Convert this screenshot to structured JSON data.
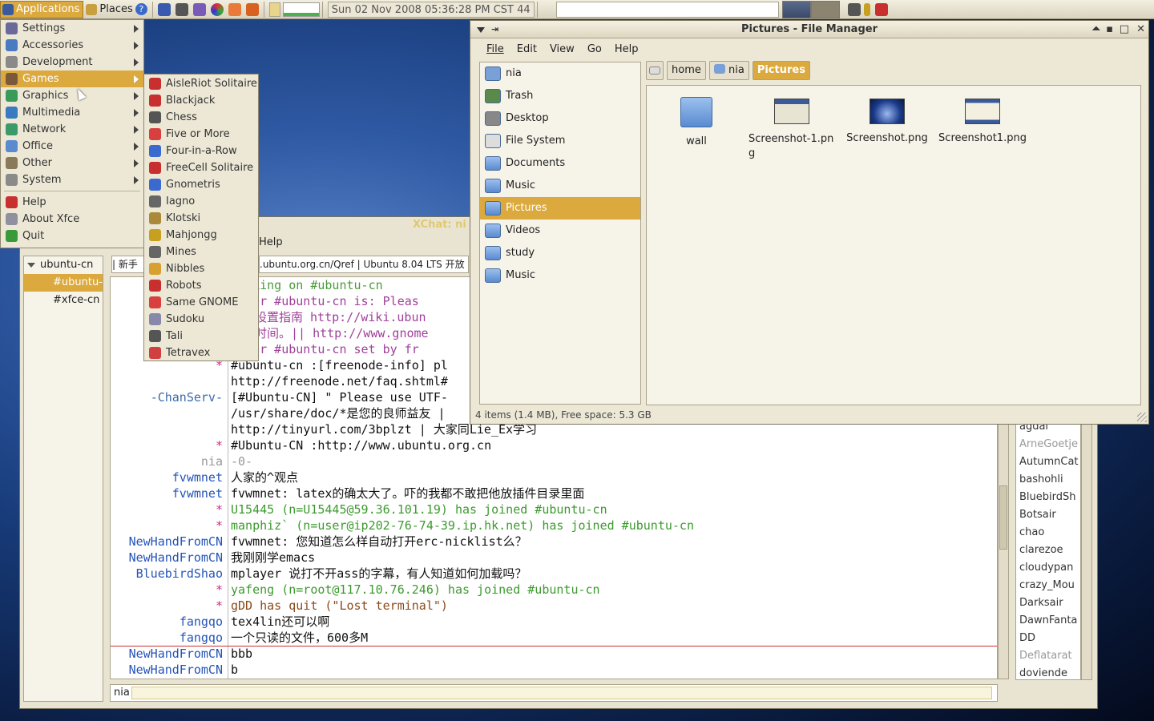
{
  "panel": {
    "applications": "Applications",
    "places": "Places",
    "clock": "Sun 02 Nov 2008 05:36:28 PM CST 44"
  },
  "app_menu": {
    "items": [
      {
        "label": "Settings",
        "sub": true
      },
      {
        "label": "Accessories",
        "sub": true
      },
      {
        "label": "Development",
        "sub": true
      },
      {
        "label": "Games",
        "sub": true,
        "selected": true
      },
      {
        "label": "Graphics",
        "sub": true
      },
      {
        "label": "Multimedia",
        "sub": true
      },
      {
        "label": "Network",
        "sub": true
      },
      {
        "label": "Office",
        "sub": true
      },
      {
        "label": "Other",
        "sub": true
      },
      {
        "label": "System",
        "sub": true
      },
      {
        "label": "Help"
      },
      {
        "label": "About Xfce"
      },
      {
        "label": "Quit"
      }
    ]
  },
  "games_menu": {
    "items": [
      "AisleRiot Solitaire",
      "Blackjack",
      "Chess",
      "Five or More",
      "Four-in-a-Row",
      "FreeCell Solitaire",
      "Gnometris",
      "Iagno",
      "Klotski",
      "Mahjongg",
      "Mines",
      "Nibbles",
      "Robots",
      "Same GNOME",
      "Sudoku",
      "Tali",
      "Tetravex"
    ]
  },
  "xchat": {
    "title_fragment": "XChat: ni",
    "menu_help": "Help",
    "tree": {
      "server": "ubuntu-cn",
      "channels": [
        "#ubuntu-",
        "#xfce-cn"
      ]
    },
    "tab_fragment": "| 新手",
    "topic": ".ubuntu.org.cn/Qref | Ubuntu 8.04 LTS 开放",
    "lines": [
      {
        "nick": "",
        "text": "talking on #ubuntu-cn",
        "color": "#4a9a3a"
      },
      {
        "nick": "",
        "text": "c for #ubuntu-cn is: Pleas",
        "color": "#a0409a"
      },
      {
        "nick": "",
        "text": "中文设置指南 http://wiki.ubun",
        "color": "#a0409a"
      },
      {
        "nick": "",
        "text": "大家时间。|| http://www.gnome",
        "color": "#a0409a"
      },
      {
        "nick": "",
        "text": "c for #ubuntu-cn set by fr",
        "color": "#a0409a"
      },
      {
        "nick": "*",
        "text": "#ubuntu-cn :[freenode-info] pl",
        "color": "#111"
      },
      {
        "nick": "",
        "text": "http://freenode.net/faq.shtml#",
        "color": "#111"
      },
      {
        "nick": "-ChanServ-",
        "text": "[#Ubuntu-CN] \" Please use UTF-",
        "color": "#111"
      },
      {
        "nick": "",
        "text": "/usr/share/doc/*是您的良师益友 |",
        "color": "#111"
      },
      {
        "nick": "",
        "text": "http://tinyurl.com/3bplzt | 大家同Lie_Ex学习",
        "color": "#111"
      },
      {
        "nick": "*",
        "text": "#Ubuntu-CN :http://www.ubuntu.org.cn",
        "color": "#111"
      },
      {
        "nick": "nia",
        "text": "-0-",
        "color": "#999"
      },
      {
        "nick": "fvwmnet",
        "text": "人家的^观点",
        "color": "#111"
      },
      {
        "nick": "fvwmnet",
        "text": "fvwmnet: latex的确太大了。吓的我都不敢把他放插件目录里面",
        "color": "#111"
      },
      {
        "nick": "*",
        "text": "U15445 (n=U15445@59.36.101.19) has joined #ubuntu-cn",
        "color": "#3c9a2e"
      },
      {
        "nick": "*",
        "text": "manphiz` (n=user@ip202-76-74-39.ip.hk.net) has joined #ubuntu-cn",
        "color": "#3c9a2e"
      },
      {
        "nick": "NewHandFromCN",
        "text": "fvwmnet: 您知道怎么样自动打开erc-nicklist么？",
        "color": "#111"
      },
      {
        "nick": "NewHandFromCN",
        "text": "我刚刚学emacs",
        "color": "#111"
      },
      {
        "nick": "BluebirdShao",
        "text": "mplayer 说打不开ass的字幕，有人知道如何加载吗？",
        "color": "#111"
      },
      {
        "nick": "*",
        "text": "yafeng (n=root@117.10.76.246) has joined #ubuntu-cn",
        "color": "#3c9a2e"
      },
      {
        "nick": "*",
        "text": "gDD has quit (\"Lost terminal\")",
        "color": "#8a4a1a"
      },
      {
        "nick": "fangqo",
        "text": "tex4lin还可以啊",
        "color": "#111"
      },
      {
        "nick": "fangqo",
        "text": "一个只读的文件，600多M",
        "color": "#111"
      },
      {
        "nick": "NewHandFromCN",
        "text": "bbb",
        "color": "#111"
      },
      {
        "nick": "NewHandFromCN",
        "text": "b",
        "color": "#111"
      }
    ],
    "input_nick": "nia",
    "nicks": [
      "agdai",
      "ArneGoetje",
      "AutumnCat",
      "bashohli",
      "BluebirdSh",
      "Botsair",
      "chao",
      "clarezoe",
      "cloudypan",
      "crazy_Mou",
      "Darksair",
      "DawnFanta",
      "DD",
      "Deflatarat",
      "doviende"
    ]
  },
  "fm": {
    "title": "Pictures - File Manager",
    "menu": [
      "File",
      "Edit",
      "View",
      "Go",
      "Help"
    ],
    "sidebar": [
      {
        "label": "nia"
      },
      {
        "label": "Trash"
      },
      {
        "label": "Desktop"
      },
      {
        "label": "File System"
      },
      {
        "label": "Documents"
      },
      {
        "label": "Music"
      },
      {
        "label": "Pictures",
        "selected": true
      },
      {
        "label": "Videos"
      },
      {
        "label": "study"
      },
      {
        "label": "Music"
      }
    ],
    "breadcrumbs": [
      "home",
      "nia",
      "Pictures"
    ],
    "files": [
      {
        "name": "wall",
        "type": "folder"
      },
      {
        "name": "Screenshot-1.png",
        "type": "image"
      },
      {
        "name": "Screenshot.png",
        "type": "image"
      },
      {
        "name": "Screenshot1.png",
        "type": "image"
      }
    ],
    "status": "4 items (1.4 MB), Free space: 5.3 GB"
  },
  "colors": {
    "accent": "#dba93d",
    "menu_bg": "#ede8d6"
  }
}
